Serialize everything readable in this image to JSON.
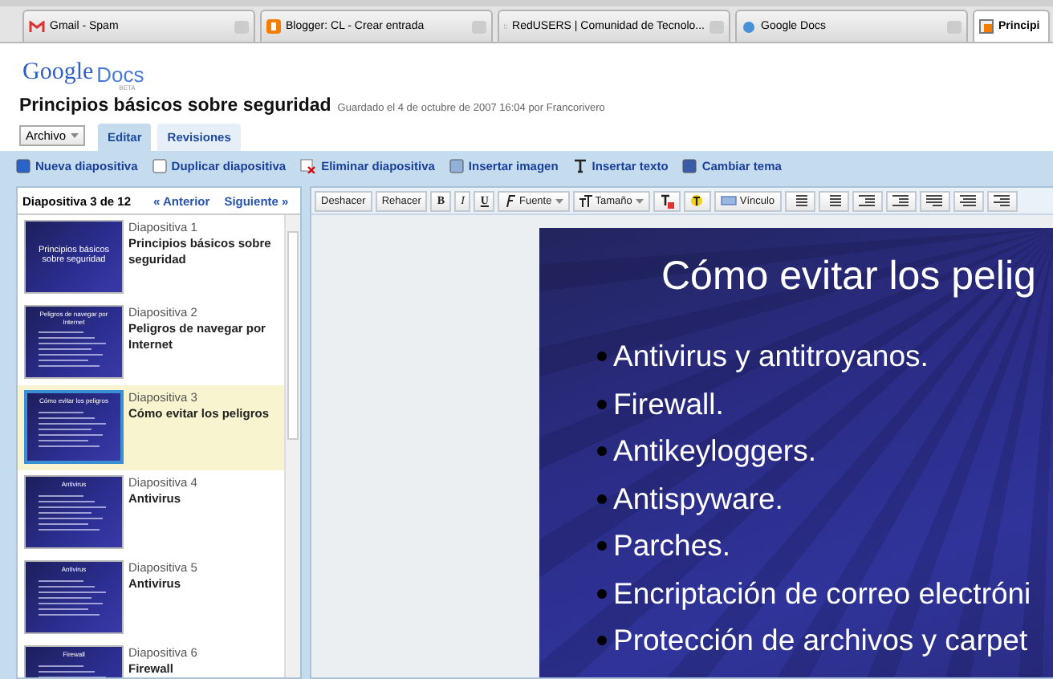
{
  "browser_tabs": [
    {
      "label": "Gmail - Spam",
      "selected": false
    },
    {
      "label": "Blogger: CL - Crear entrada",
      "selected": false
    },
    {
      "label": "RedUSERS | Comunidad de Tecnolo...",
      "selected": false
    },
    {
      "label": "Google Docs",
      "selected": false
    },
    {
      "label": "Principi",
      "selected": true
    }
  ],
  "logo": {
    "brand": "Google",
    "product": "Docs",
    "badge": "BETA"
  },
  "document": {
    "title": "Principios básicos sobre seguridad",
    "saved": "Guardado el 4 de octubre de 2007 16:04 por Francorivero"
  },
  "menu": {
    "file": "Archivo",
    "tabs": [
      {
        "label": "Editar",
        "selected": true
      },
      {
        "label": "Revisiones",
        "selected": false
      }
    ]
  },
  "actions": [
    "Nueva diapositiva",
    "Duplicar diapositiva",
    "Eliminar diapositiva",
    "Insertar imagen",
    "Insertar texto",
    "Cambiar tema"
  ],
  "navigator": {
    "counter": "Diapositiva 3 de 12",
    "prev": "« Anterior",
    "next": "Siguiente »"
  },
  "slides": [
    {
      "number": "Diapositiva 1",
      "title": "Principios básicos sobre seguridad",
      "thumbnail_title": "Principios básicos sobre seguridad",
      "kind": "cover",
      "selected": false
    },
    {
      "number": "Diapositiva 2",
      "title": "Peligros de navegar por Internet",
      "thumbnail_title": "Peligros de navegar por Internet",
      "kind": "list",
      "selected": false
    },
    {
      "number": "Diapositiva 3",
      "title": "Cómo evitar los peligros",
      "thumbnail_title": "Cómo evitar los peligros",
      "kind": "list",
      "selected": true
    },
    {
      "number": "Diapositiva 4",
      "title": "Antivirus",
      "thumbnail_title": "Antivirus",
      "kind": "list",
      "selected": false
    },
    {
      "number": "Diapositiva 5",
      "title": "Antivirus",
      "thumbnail_title": "Antivirus",
      "kind": "list",
      "selected": false
    },
    {
      "number": "Diapositiva 6",
      "title": "Firewall",
      "thumbnail_title": "Firewall",
      "kind": "list",
      "selected": false
    }
  ],
  "editor_toolbar": {
    "undo": "Deshacer",
    "redo": "Rehacer",
    "bold": "B",
    "italic": "I",
    "underline": "U",
    "font": "Fuente",
    "size": "Tamaño",
    "link": "Vínculo"
  },
  "current_slide": {
    "title": "Cómo evitar los pelig",
    "bullets": [
      "Antivirus y antitroyanos.",
      "Firewall.",
      "Antikeyloggers.",
      "Antispyware.",
      "Parches.",
      "Encriptación de correo electróni",
      "Protección de archivos y carpet"
    ]
  }
}
